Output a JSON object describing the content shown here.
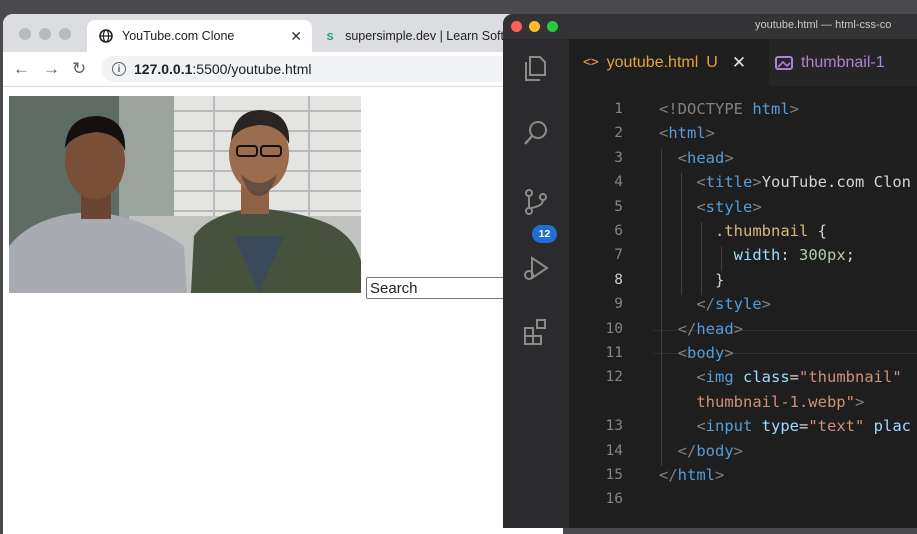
{
  "browser": {
    "tabs": [
      {
        "title": "YouTube.com Clone",
        "active": true
      },
      {
        "title": "supersimple.dev | Learn Softw",
        "active": false
      }
    ],
    "url_host": "127.0.0.1",
    "url_rest": ":5500/youtube.html",
    "search_value": "Search"
  },
  "editor": {
    "window_title": "youtube.html — html-css-co",
    "tabs": [
      {
        "filename": "youtube.html",
        "status": "U",
        "icon": "code-file-icon",
        "color": "#e8a33d"
      },
      {
        "filename": "thumbnail-1",
        "icon": "image-file-icon",
        "color": "#b180d7"
      }
    ],
    "scm_badge": "12",
    "line_numbers": [
      "1",
      "2",
      "3",
      "4",
      "5",
      "6",
      "7",
      "8",
      "9",
      "10",
      "11",
      "12",
      "",
      "13",
      "14",
      "15",
      "16"
    ],
    "current_line": "8",
    "lines": [
      [
        {
          "t": "<!DOCTYPE ",
          "c": "br"
        },
        {
          "t": "html",
          "c": "tag"
        },
        {
          "t": ">",
          "c": "br"
        }
      ],
      [
        {
          "t": "<",
          "c": "br"
        },
        {
          "t": "html",
          "c": "tag"
        },
        {
          "t": ">",
          "c": "br"
        }
      ],
      [
        {
          "t": "  ",
          "c": "text"
        },
        {
          "t": "<",
          "c": "br"
        },
        {
          "t": "head",
          "c": "tag"
        },
        {
          "t": ">",
          "c": "br"
        }
      ],
      [
        {
          "t": "    ",
          "c": "text"
        },
        {
          "t": "<",
          "c": "br"
        },
        {
          "t": "title",
          "c": "tag"
        },
        {
          "t": ">",
          "c": "br"
        },
        {
          "t": "YouTube.com Clon",
          "c": "text"
        }
      ],
      [
        {
          "t": "    ",
          "c": "text"
        },
        {
          "t": "<",
          "c": "br"
        },
        {
          "t": "style",
          "c": "tag"
        },
        {
          "t": ">",
          "c": "br"
        }
      ],
      [
        {
          "t": "      ",
          "c": "text"
        },
        {
          "t": ".thumbnail ",
          "c": "sel"
        },
        {
          "t": "{",
          "c": "text"
        }
      ],
      [
        {
          "t": "        ",
          "c": "text"
        },
        {
          "t": "width",
          "c": "attr"
        },
        {
          "t": ": ",
          "c": "text"
        },
        {
          "t": "300px",
          "c": "num"
        },
        {
          "t": ";",
          "c": "text"
        }
      ],
      [
        {
          "t": "      ",
          "c": "text"
        },
        {
          "t": "}",
          "c": "text"
        }
      ],
      [
        {
          "t": "    ",
          "c": "text"
        },
        {
          "t": "</",
          "c": "br"
        },
        {
          "t": "style",
          "c": "tag"
        },
        {
          "t": ">",
          "c": "br"
        }
      ],
      [
        {
          "t": "  ",
          "c": "text"
        },
        {
          "t": "</",
          "c": "br"
        },
        {
          "t": "head",
          "c": "tag"
        },
        {
          "t": ">",
          "c": "br"
        }
      ],
      [
        {
          "t": "  ",
          "c": "text"
        },
        {
          "t": "<",
          "c": "br"
        },
        {
          "t": "body",
          "c": "tag"
        },
        {
          "t": ">",
          "c": "br"
        }
      ],
      [
        {
          "t": "    ",
          "c": "text"
        },
        {
          "t": "<",
          "c": "br"
        },
        {
          "t": "img ",
          "c": "tag"
        },
        {
          "t": "class",
          "c": "attr"
        },
        {
          "t": "=",
          "c": "text"
        },
        {
          "t": "\"thumbnail\"",
          "c": "str"
        }
      ],
      [
        {
          "t": "    ",
          "c": "text"
        },
        {
          "t": "thumbnail-1.webp",
          "c": "str"
        },
        {
          "t": "\"",
          "c": "str"
        },
        {
          "t": ">",
          "c": "br"
        }
      ],
      [
        {
          "t": "    ",
          "c": "text"
        },
        {
          "t": "<",
          "c": "br"
        },
        {
          "t": "input ",
          "c": "tag"
        },
        {
          "t": "type",
          "c": "attr"
        },
        {
          "t": "=",
          "c": "text"
        },
        {
          "t": "\"text\"",
          "c": "str"
        },
        {
          "t": " plac",
          "c": "attr"
        }
      ],
      [
        {
          "t": "  ",
          "c": "text"
        },
        {
          "t": "</",
          "c": "br"
        },
        {
          "t": "body",
          "c": "tag"
        },
        {
          "t": ">",
          "c": "br"
        }
      ],
      [
        {
          "t": "</",
          "c": "br"
        },
        {
          "t": "html",
          "c": "tag"
        },
        {
          "t": ">",
          "c": "br"
        }
      ],
      []
    ]
  }
}
